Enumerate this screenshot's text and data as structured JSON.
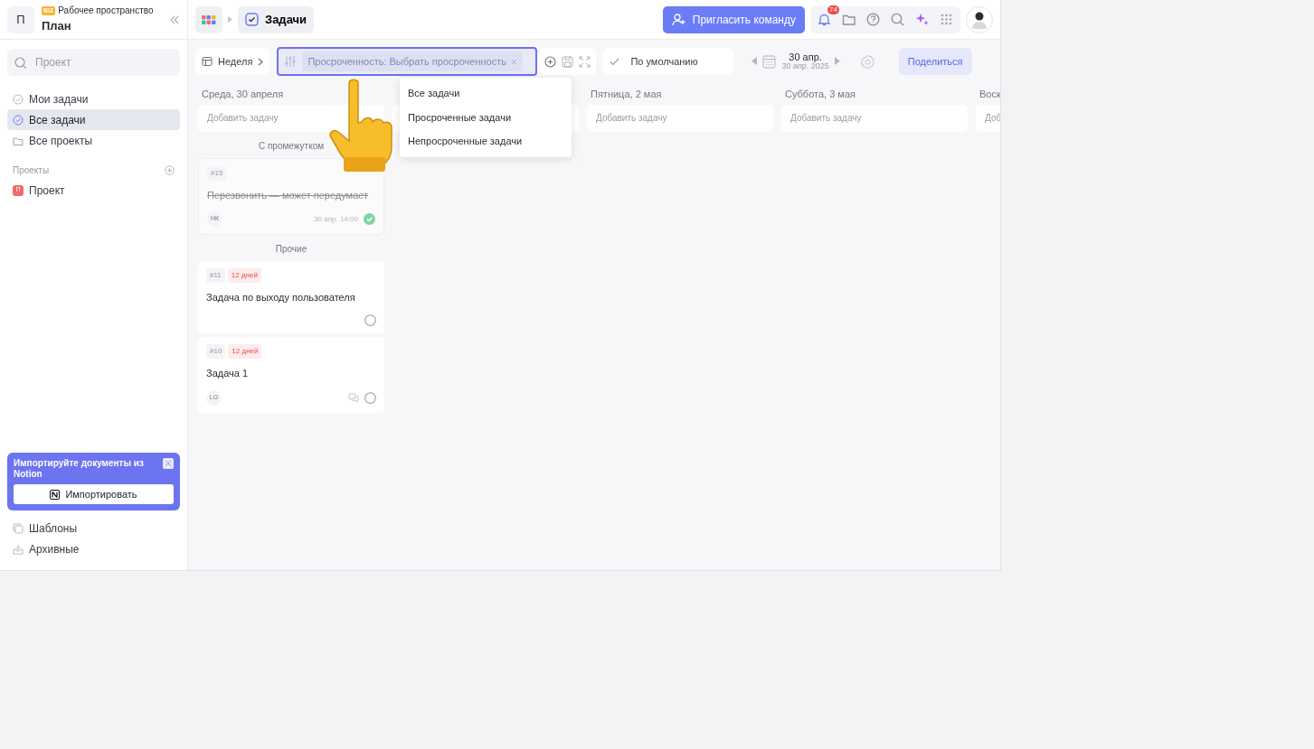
{
  "workspace": {
    "avatar": "П",
    "badge": "BIZ",
    "label": "Рабочее пространство",
    "name": "План"
  },
  "breadcrumb": {
    "title": "Задачи"
  },
  "header": {
    "invite_button": "Пригласить команду",
    "notifications": "74"
  },
  "sidebar": {
    "search": {
      "placeholder": "Проект"
    },
    "items": [
      {
        "label": "Мои задачи",
        "selected": false
      },
      {
        "label": "Все задачи",
        "selected": true
      },
      {
        "label": "Все проекты",
        "selected": false
      }
    ],
    "projects_heading": "Проекты",
    "projects": [
      {
        "letter": "П",
        "label": "Проект",
        "color": "#f06a6a"
      }
    ],
    "import_banner": {
      "text": "Импортируйте документы из Notion",
      "button": "Импортировать"
    },
    "bottom_items": [
      {
        "kind": "templates",
        "label": "Шаблоны"
      },
      {
        "kind": "archive",
        "label": "Архивные"
      }
    ]
  },
  "toolbar": {
    "view": "Неделя",
    "filter": "Просроченность: Выбрать просроченность",
    "sort": "По умолчанию",
    "date": "30 апр.",
    "date_sub": "30 апр. 2025",
    "share": "Поделиться"
  },
  "dropdown": {
    "options": [
      {
        "label": "Все задачи"
      },
      {
        "label": "Просроченные задачи"
      },
      {
        "label": "Непросроченные задачи"
      }
    ]
  },
  "columns": [
    {
      "header": "Среда, 30 апреля",
      "add_placeholder": "Добавить задачу",
      "groups": [
        {
          "title": "С промежутком",
          "cards": [
            {
              "number": "#15",
              "title": "Перезвонить — может передумает",
              "done": true,
              "assignee": "НК",
              "due": "30 апр. 14:00"
            }
          ]
        },
        {
          "title": "Прочие",
          "cards": [
            {
              "number": "#11",
              "overdue": "12 дней",
              "title": "Задача по выходу пользователя",
              "done": false
            },
            {
              "number": "#10",
              "overdue": "12 дней",
              "title": "Задача 1",
              "done": false,
              "assignee": "LG",
              "comments": true
            }
          ]
        }
      ]
    },
    {
      "covered": true
    },
    {
      "header": "Пятница, 2 мая",
      "add_placeholder": "Добавить задачу"
    },
    {
      "header": "Суббота, 3 мая",
      "add_placeholder": "Добавить задачу"
    },
    {
      "header": "Воск",
      "add_placeholder": "Доб"
    }
  ]
}
